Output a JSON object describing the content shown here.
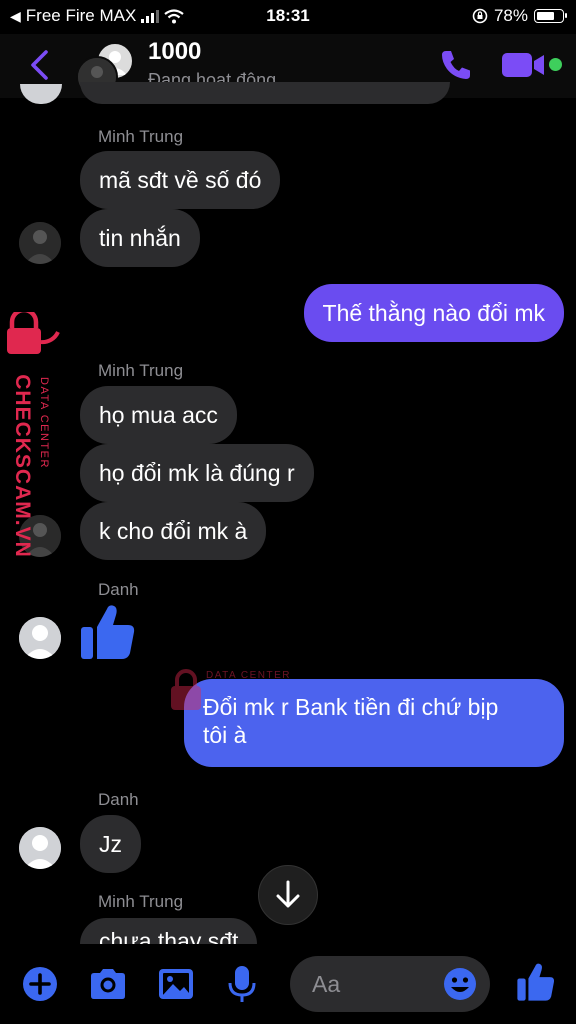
{
  "status_bar": {
    "carrier": "Free Fire MAX",
    "time": "18:31",
    "battery": "78%",
    "battery_level": 0.78
  },
  "header": {
    "name": "1000",
    "status": "Đang hoạt động"
  },
  "messages": [
    {
      "sender": "Minh Trung"
    },
    {
      "text": "mã sđt về số đó"
    },
    {
      "text": "tin nhắn"
    },
    {
      "text": "Thế thằng nào đổi mk"
    },
    {
      "sender": "Minh Trung"
    },
    {
      "text": "họ mua acc"
    },
    {
      "text": "họ đổi mk là đúng r"
    },
    {
      "text": "k cho đổi mk à"
    },
    {
      "sender": "Danh"
    },
    {
      "text": "Đổi mk r Bank tiền đi chứ bịp",
      "text2": "tôi à"
    },
    {
      "sender": "Danh"
    },
    {
      "text": "Jz"
    },
    {
      "sender": "Minh Trung"
    },
    {
      "text": "chưa thay sđt"
    }
  ],
  "watermark": {
    "brand": "CHECKSCAM.VN",
    "sub": "DATA CENTER"
  },
  "composer": {
    "placeholder": "Aa"
  },
  "colors": {
    "accent": "#7b4cf6",
    "outgoing_purple": "#6a4cf0",
    "outgoing_blue": "#4c63ee",
    "incoming": "#2c2c2e",
    "like": "#3b68f0",
    "online": "#3ecf5c"
  },
  "icons": [
    "back-icon",
    "phone-icon",
    "video-icon",
    "thumbs-up-icon",
    "plus-icon",
    "camera-icon",
    "image-icon",
    "mic-icon",
    "emoji-icon",
    "arrow-down-icon"
  ]
}
